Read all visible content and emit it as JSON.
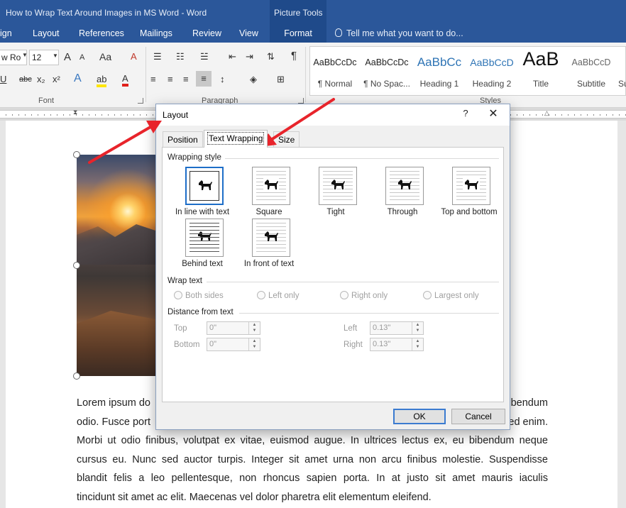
{
  "window": {
    "title": "How to Wrap Text Around Images in MS Word - Word",
    "context_tab_group": "Picture Tools"
  },
  "ribbon_tabs": [
    "ign",
    "Layout",
    "References",
    "Mailings",
    "Review",
    "View",
    "Format"
  ],
  "tell_me": "Tell me what you want to do...",
  "font": {
    "name": "w Ro",
    "size": "12",
    "group_label": "Font",
    "glyphs": {
      "grow": "A",
      "shrink": "A",
      "case": "Aa",
      "underline": "U",
      "strike": "abc",
      "subscript": "x₂",
      "superscript": "x²",
      "text_effects": "A",
      "highlight": "ab",
      "font_color": "A"
    }
  },
  "paragraph": {
    "group_label": "Paragraph",
    "show_marks": "¶"
  },
  "styles": {
    "group_label": "Styles",
    "items": [
      {
        "preview": "AaBbCcDc",
        "name": "¶ Normal"
      },
      {
        "preview": "AaBbCcDc",
        "name": "¶ No Spac..."
      },
      {
        "preview": "AaBbCc",
        "name": "Heading 1"
      },
      {
        "preview": "AaBbCcD",
        "name": "Heading 2"
      },
      {
        "preview": "AaB",
        "name": "Title"
      },
      {
        "preview": "AaBbCcD",
        "name": "Subtitle"
      },
      {
        "preview": "",
        "name": "Su"
      }
    ]
  },
  "dialog": {
    "title": "Layout",
    "help": "?",
    "close": "✕",
    "tabs": [
      "Position",
      "Text Wrapping",
      "Size"
    ],
    "active_tab": "Text Wrapping",
    "wrapping_style_label": "Wrapping style",
    "wrapping_options": [
      {
        "label": "In line with text",
        "selected": true
      },
      {
        "label": "Square",
        "selected": false
      },
      {
        "label": "Tight",
        "selected": false
      },
      {
        "label": "Through",
        "selected": false
      },
      {
        "label": "Top and bottom",
        "selected": false
      },
      {
        "label": "Behind text",
        "selected": false
      },
      {
        "label": "In front of text",
        "selected": false
      }
    ],
    "wrap_text_label": "Wrap text",
    "wrap_text_options": [
      "Both sides",
      "Left only",
      "Right only",
      "Largest only"
    ],
    "distance_label": "Distance from text",
    "distance": {
      "top_label": "Top",
      "top_value": "0\"",
      "bottom_label": "Bottom",
      "bottom_value": "0\"",
      "left_label": "Left",
      "left_value": "0.13\"",
      "right_label": "Right",
      "right_value": "0.13\""
    },
    "ok": "OK",
    "cancel": "Cancel"
  },
  "document": {
    "line1_left": "Lorem ipsum do",
    "line1_right": "bendum",
    "line2_left": "odio. Fusce port",
    "line2_right": "ed enim.",
    "lines": [
      "Morbi ut odio finibus, volutpat ex vitae, euismod augue. In ultrices lectus ex, eu bibendum neque",
      "cursus eu. Nunc sed auctor turpis. Integer sit amet urna non arcu finibus molestie. Suspendisse",
      "blandit felis a leo pellentesque, non rhoncus sapien porta. In at justo sit amet mauris iaculis",
      "tincidunt sit amet ac elit. Maecenas vel dolor pharetra elit elementum eleifend."
    ]
  },
  "colors": {
    "word_blue": "#2b579a",
    "annotation_arrow": "#e8242b",
    "selected_border": "#1e6ec8"
  }
}
